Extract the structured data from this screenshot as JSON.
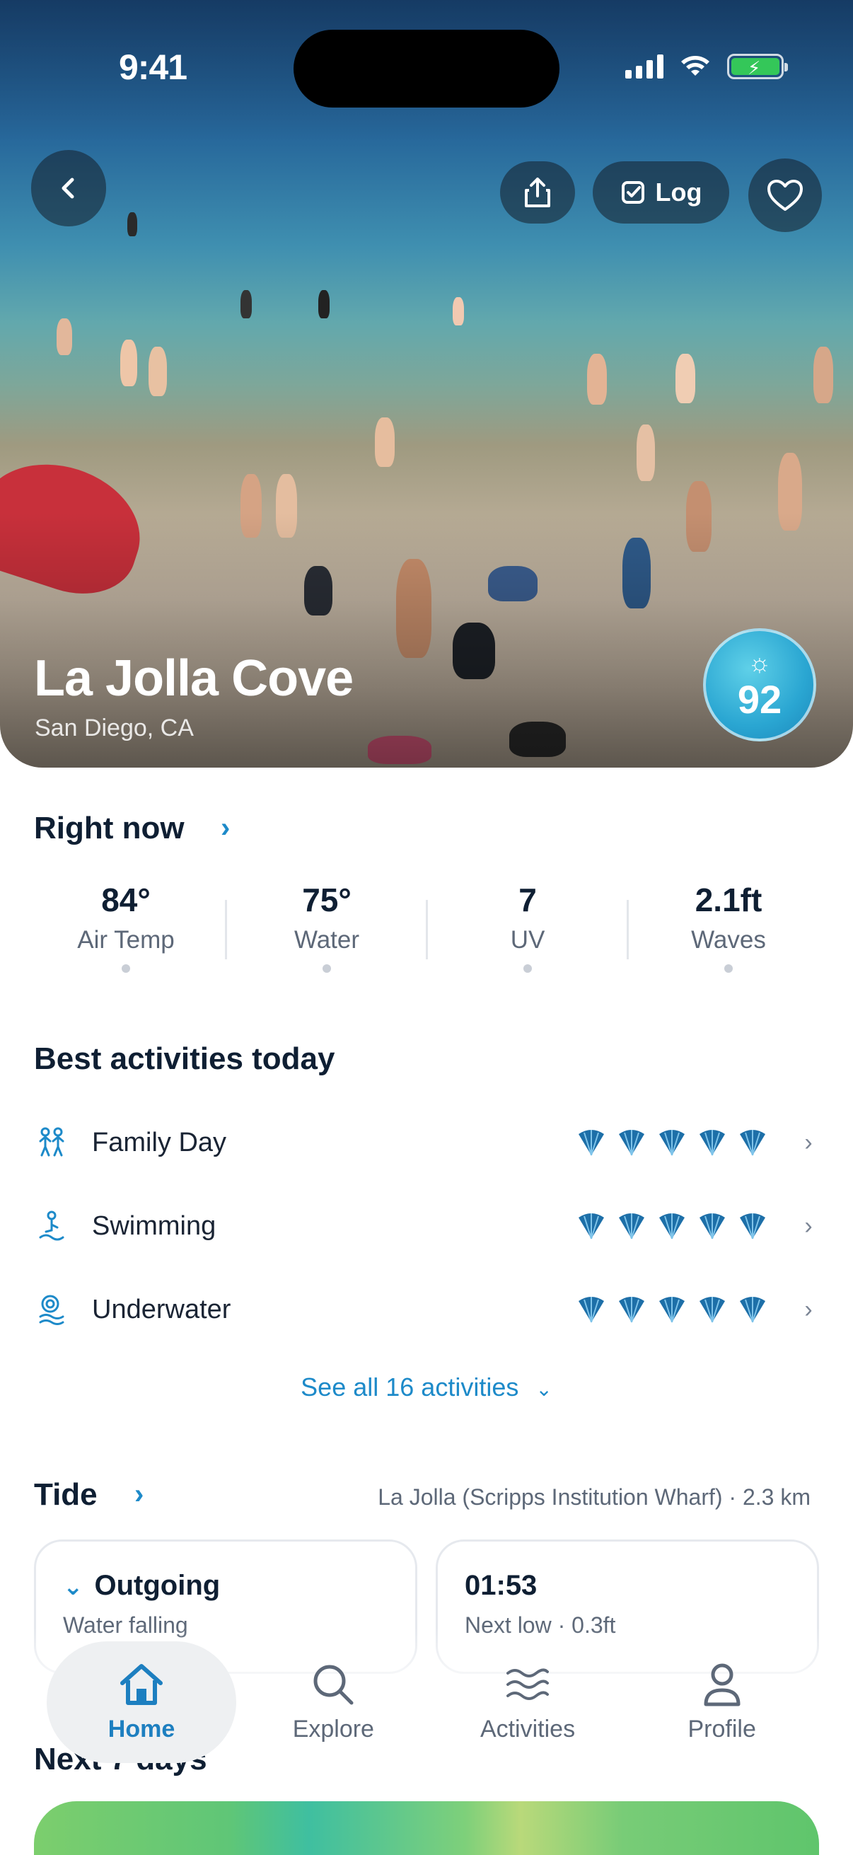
{
  "status_bar": {
    "time": "9:41"
  },
  "hero": {
    "title": "La Jolla Cove",
    "subtitle": "San Diego, CA",
    "score": "92",
    "log_label": "Log"
  },
  "right_now": {
    "title": "Right now",
    "stats": [
      {
        "value": "84°",
        "label": "Air Temp"
      },
      {
        "value": "75°",
        "label": "Water"
      },
      {
        "value": "7",
        "label": "UV"
      },
      {
        "value": "2.1ft",
        "label": "Waves"
      }
    ]
  },
  "activities": {
    "title": "Best activities today",
    "items": [
      {
        "label": "Family Day",
        "rating": 5,
        "icon": "family-icon"
      },
      {
        "label": "Swimming",
        "rating": 5,
        "icon": "swimmer-icon"
      },
      {
        "label": "Underwater",
        "rating": 5,
        "icon": "snorkel-icon"
      }
    ],
    "see_all": "See all 16 activities"
  },
  "tide": {
    "title": "Tide",
    "station": "La Jolla (Scripps Institution Wharf) · 2.3 km",
    "cards": [
      {
        "title": "Outgoing",
        "subtitle": "Water falling"
      },
      {
        "title": "01:53",
        "subtitle": "Next low · 0.3ft"
      }
    ]
  },
  "next_section": {
    "title": "Next 7 days"
  },
  "nav": {
    "items": [
      {
        "label": "Home",
        "icon": "home-icon",
        "active": true
      },
      {
        "label": "Explore",
        "icon": "search-icon",
        "active": false
      },
      {
        "label": "Activities",
        "icon": "waves-icon",
        "active": false
      },
      {
        "label": "Profile",
        "icon": "person-icon",
        "active": false
      }
    ]
  },
  "colors": {
    "accent": "#1d8ac9",
    "nav_active": "#1d7fc0",
    "shell": "#1d6fa8",
    "battery": "#34c759"
  }
}
